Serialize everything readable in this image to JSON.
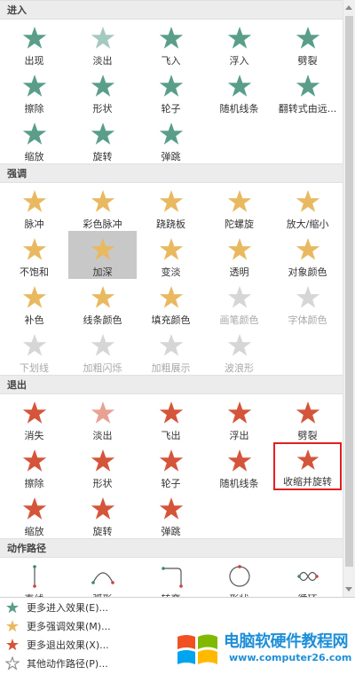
{
  "sections": [
    {
      "title": "进入",
      "color": "#5a9e8a",
      "items": [
        {
          "label": "出现",
          "icon": "appear-star-icon"
        },
        {
          "label": "淡出",
          "icon": "fade-star-icon"
        },
        {
          "label": "飞入",
          "icon": "fly-in-star-icon"
        },
        {
          "label": "浮入",
          "icon": "float-in-star-icon"
        },
        {
          "label": "劈裂",
          "icon": "split-star-icon"
        },
        {
          "label": "擦除",
          "icon": "wipe-star-icon"
        },
        {
          "label": "形状",
          "icon": "shape-star-icon"
        },
        {
          "label": "轮子",
          "icon": "wheel-star-icon"
        },
        {
          "label": "随机线条",
          "icon": "random-bars-star-icon"
        },
        {
          "label": "翻转式由远...",
          "icon": "grow-turn-star-icon"
        },
        {
          "label": "缩放",
          "icon": "zoom-star-icon"
        },
        {
          "label": "旋转",
          "icon": "swivel-star-icon"
        },
        {
          "label": "弹跳",
          "icon": "bounce-star-icon"
        }
      ]
    },
    {
      "title": "强调",
      "color": "#e8b960",
      "items": [
        {
          "label": "脉冲",
          "icon": "pulse-star-icon"
        },
        {
          "label": "彩色脉冲",
          "icon": "color-pulse-star-icon"
        },
        {
          "label": "跷跷板",
          "icon": "teeter-star-icon"
        },
        {
          "label": "陀螺旋",
          "icon": "spin-star-icon"
        },
        {
          "label": "放大/缩小",
          "icon": "grow-shrink-star-icon"
        },
        {
          "label": "不饱和",
          "icon": "desaturate-star-icon"
        },
        {
          "label": "加深",
          "icon": "darken-star-icon"
        },
        {
          "label": "变淡",
          "icon": "lighten-star-icon"
        },
        {
          "label": "透明",
          "icon": "transparency-star-icon"
        },
        {
          "label": "对象颜色",
          "icon": "object-color-star-icon"
        },
        {
          "label": "补色",
          "icon": "complementary-color-star-icon"
        },
        {
          "label": "线条颜色",
          "icon": "line-color-star-icon"
        },
        {
          "label": "填充颜色",
          "icon": "fill-color-star-icon"
        },
        {
          "label": "画笔颜色",
          "icon": "brush-color-icon"
        },
        {
          "label": "字体颜色",
          "icon": "font-color-icon"
        },
        {
          "label": "下划线",
          "icon": "underline-icon"
        },
        {
          "label": "加粗闪烁",
          "icon": "bold-flash-icon"
        },
        {
          "label": "加粗展示",
          "icon": "bold-reveal-icon"
        },
        {
          "label": "波浪形",
          "icon": "wave-icon"
        }
      ]
    },
    {
      "title": "退出",
      "color": "#d5553a",
      "items": [
        {
          "label": "消失",
          "icon": "disappear-star-icon"
        },
        {
          "label": "淡出",
          "icon": "fade-out-star-icon"
        },
        {
          "label": "飞出",
          "icon": "fly-out-star-icon"
        },
        {
          "label": "浮出",
          "icon": "float-out-star-icon"
        },
        {
          "label": "劈裂",
          "icon": "split-exit-star-icon"
        },
        {
          "label": "擦除",
          "icon": "wipe-exit-star-icon"
        },
        {
          "label": "形状",
          "icon": "shape-exit-star-icon"
        },
        {
          "label": "轮子",
          "icon": "wheel-exit-star-icon"
        },
        {
          "label": "随机线条",
          "icon": "random-bars-exit-star-icon"
        },
        {
          "label": "收缩并旋转",
          "icon": "shrink-turn-star-icon"
        },
        {
          "label": "缩放",
          "icon": "zoom-exit-star-icon"
        },
        {
          "label": "旋转",
          "icon": "swivel-exit-star-icon"
        },
        {
          "label": "弹跳",
          "icon": "bounce-exit-star-icon"
        }
      ]
    },
    {
      "title": "动作路径",
      "color": "#4a8b7a",
      "items": [
        {
          "label": "直线",
          "icon": "line-path-icon"
        },
        {
          "label": "弧形",
          "icon": "arc-path-icon"
        },
        {
          "label": "转弯",
          "icon": "turn-path-icon"
        },
        {
          "label": "形状",
          "icon": "shape-path-icon"
        },
        {
          "label": "循环",
          "icon": "loop-path-icon"
        }
      ]
    }
  ],
  "bottom_links": [
    {
      "label": "更多进入效果(E)...",
      "icon": "entrance-star-icon",
      "color": "#5a9e8a"
    },
    {
      "label": "更多强调效果(M)...",
      "icon": "emphasis-star-icon",
      "color": "#e8b960"
    },
    {
      "label": "更多退出效果(X)...",
      "icon": "exit-star-icon",
      "color": "#d5553a"
    },
    {
      "label": "其他动作路径(P)...",
      "icon": "motion-path-star-icon",
      "color": "#888888"
    }
  ],
  "watermark": {
    "title": "电脑软硬件教程网",
    "url": "www.computer26.com"
  },
  "state": {
    "selected": "加深",
    "highlighted": "收缩并旋转"
  }
}
